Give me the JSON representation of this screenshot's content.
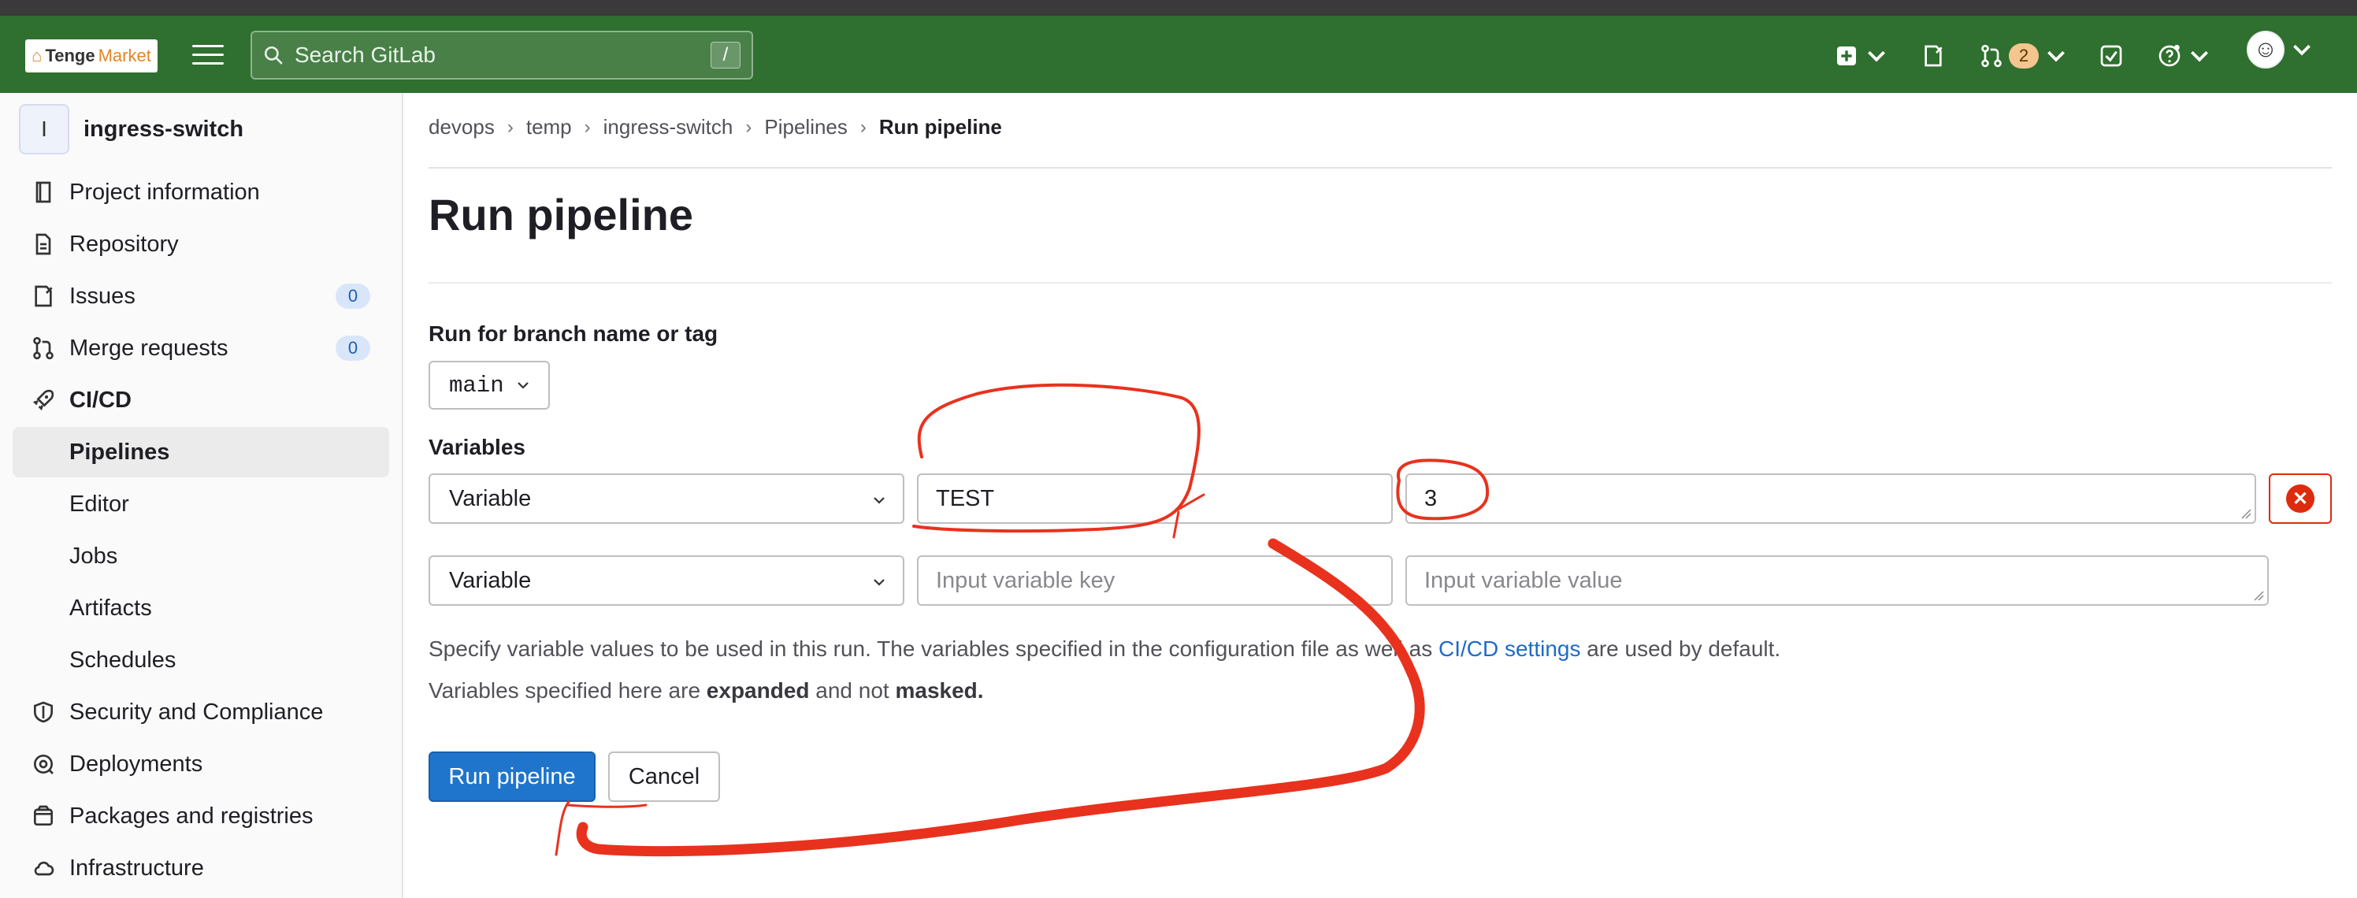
{
  "topbar": {
    "logo_text_1": "Tenge",
    "logo_text_2": "Market",
    "search_placeholder": "Search GitLab",
    "search_shortcut": "/",
    "merge_requests_count": "2"
  },
  "sidebar": {
    "project_initial": "I",
    "project_name": "ingress-switch",
    "items": [
      {
        "label": "Project information",
        "icon": "info-book-icon"
      },
      {
        "label": "Repository",
        "icon": "document-icon"
      },
      {
        "label": "Issues",
        "icon": "issues-icon",
        "count": "0"
      },
      {
        "label": "Merge requests",
        "icon": "merge-request-icon",
        "count": "0"
      },
      {
        "label": "CI/CD",
        "icon": "rocket-icon"
      },
      {
        "label": "Pipelines"
      },
      {
        "label": "Editor"
      },
      {
        "label": "Jobs"
      },
      {
        "label": "Artifacts"
      },
      {
        "label": "Schedules"
      },
      {
        "label": "Security and Compliance",
        "icon": "shield-icon"
      },
      {
        "label": "Deployments",
        "icon": "deployments-icon"
      },
      {
        "label": "Packages and registries",
        "icon": "package-icon"
      },
      {
        "label": "Infrastructure",
        "icon": "cloud-icon"
      }
    ]
  },
  "breadcrumb": [
    "devops",
    "temp",
    "ingress-switch",
    "Pipelines",
    "Run pipeline"
  ],
  "page": {
    "title": "Run pipeline",
    "branch_label": "Run for branch name or tag",
    "branch_value": "main",
    "variables_label": "Variables",
    "variables": [
      {
        "type": "Variable",
        "key": "TEST",
        "value": "3"
      },
      {
        "type": "Variable",
        "key_placeholder": "Input variable key",
        "value_placeholder": "Input variable value"
      }
    ],
    "help_line1_a": "Specify variable values to be used in this run. The variables specified in the configuration file",
    "help_line1_b": " as well as ",
    "help_link": "CI/CD settings",
    "help_line1_c": " are used by default.",
    "help_line2_a": "Variables specified here are ",
    "help_line2_b": "expanded",
    "help_line2_c": " and not ",
    "help_line2_d": "masked.",
    "run_button": "Run pipeline",
    "cancel_button": "Cancel"
  },
  "colors": {
    "topbar": "#2f6f2f",
    "primary": "#1f75cb",
    "danger": "#dd2b0e",
    "annotation": "#e8321e"
  }
}
